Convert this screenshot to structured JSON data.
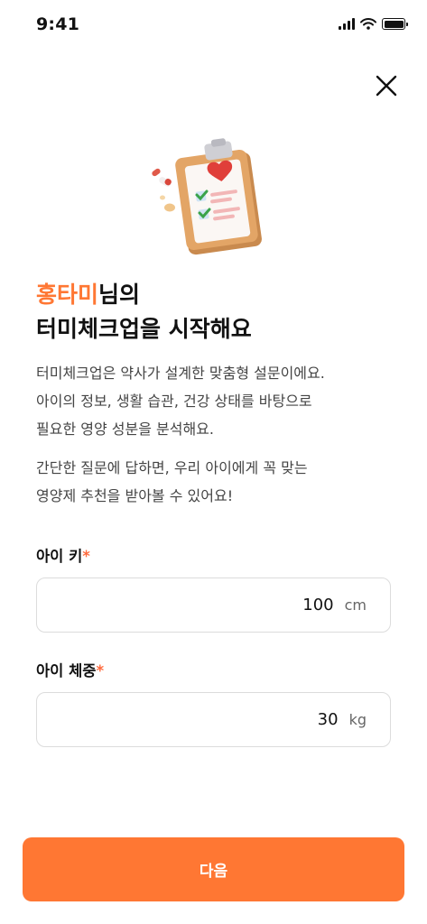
{
  "status_bar": {
    "time": "9:41"
  },
  "header": {
    "close_icon": "close-icon"
  },
  "headline": {
    "name": "홍타미",
    "name_suffix": "님의",
    "line2": "터미체크업을 시작해요"
  },
  "description": {
    "paragraph1": [
      "터미체크업은 약사가 설계한 맞춤형 설문이에요.",
      "아이의 정보, 생활 습관, 건강 상태를 바탕으로",
      "필요한 영양 성분을 분석해요."
    ],
    "paragraph2": [
      "간단한 질문에 답하면, 우리 아이에게 꼭 맞는",
      "영양제 추천을 받아볼 수 있어요!"
    ]
  },
  "form": {
    "height": {
      "label": "아이 키",
      "required_mark": "*",
      "value": "100",
      "unit": "cm"
    },
    "weight": {
      "label": "아이 체중",
      "required_mark": "*",
      "value": "30",
      "unit": "kg"
    }
  },
  "footer": {
    "next_label": "다음"
  },
  "colors": {
    "accent": "#ff7733",
    "required": "#ff6a3d"
  }
}
